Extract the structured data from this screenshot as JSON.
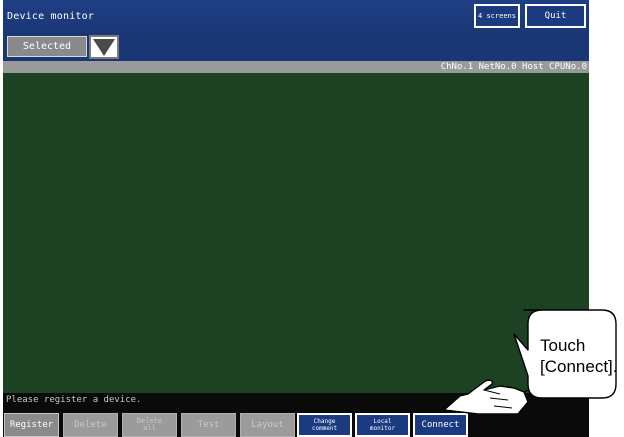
{
  "header": {
    "title": "Device monitor",
    "four_screens_label": "4 screens",
    "quit_label": "Quit"
  },
  "selector": {
    "selected_label": "Selected"
  },
  "info": {
    "connection_text": "ChNo.1 NetNo.0 Host CPUNo.0"
  },
  "status": {
    "message": "Please register a device."
  },
  "footer": {
    "register": "Register",
    "delete": "Delete",
    "delete_all_line1": "Delete",
    "delete_all_line2": "all",
    "test": "Test",
    "layout": "Layout",
    "change_comment_line1": "Change",
    "change_comment_line2": "comment",
    "local_monitor_line1": "Local",
    "local_monitor_line2": "monitor",
    "connect": "Connect"
  },
  "callout": {
    "line1": "Touch",
    "line2": "[Connect]."
  }
}
